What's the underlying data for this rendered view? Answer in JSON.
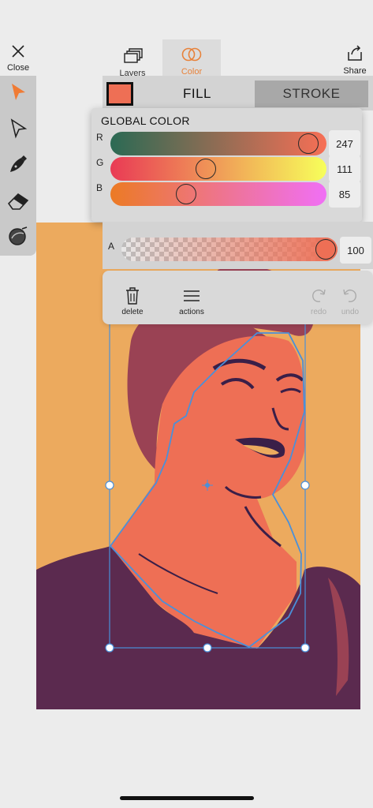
{
  "header": {
    "close_label": "Close",
    "tabs": [
      {
        "label": "Layers",
        "icon": "layers-icon"
      },
      {
        "label": "Color",
        "icon": "color-venn-icon",
        "active": true,
        "accent": "#e8823a"
      }
    ],
    "share_label": "Share"
  },
  "tools": [
    {
      "name": "select-arrow-icon",
      "active": true,
      "color": "#f07b34"
    },
    {
      "name": "direct-select-icon"
    },
    {
      "name": "pen-nib-icon"
    },
    {
      "name": "eraser-icon"
    },
    {
      "name": "shape-builder-icon"
    }
  ],
  "fill_stroke": {
    "swatch_color": "#ee6f55",
    "fill_label": "FILL",
    "stroke_label": "STROKE",
    "active": "fill"
  },
  "global_color": {
    "title": "GLOBAL COLOR",
    "channels": [
      {
        "label": "R",
        "value": "247",
        "fraction": 0.9686
      },
      {
        "label": "G",
        "value": "111",
        "fraction": 0.4353
      },
      {
        "label": "B",
        "value": "85",
        "fraction": 0.3333
      }
    ]
  },
  "alpha": {
    "label": "A",
    "value": "100",
    "fraction": 1.0
  },
  "actions": {
    "delete_label": "delete",
    "actions_label": "actions",
    "redo_label": "redo",
    "undo_label": "undo"
  },
  "colors": {
    "canvas_bg": "#ecaa5e",
    "skin": "#ee6f55",
    "shadow": "#9a4254",
    "shirt": "#5b2a4f",
    "outline": "#3a1f48",
    "selection": "#4a90d9"
  }
}
